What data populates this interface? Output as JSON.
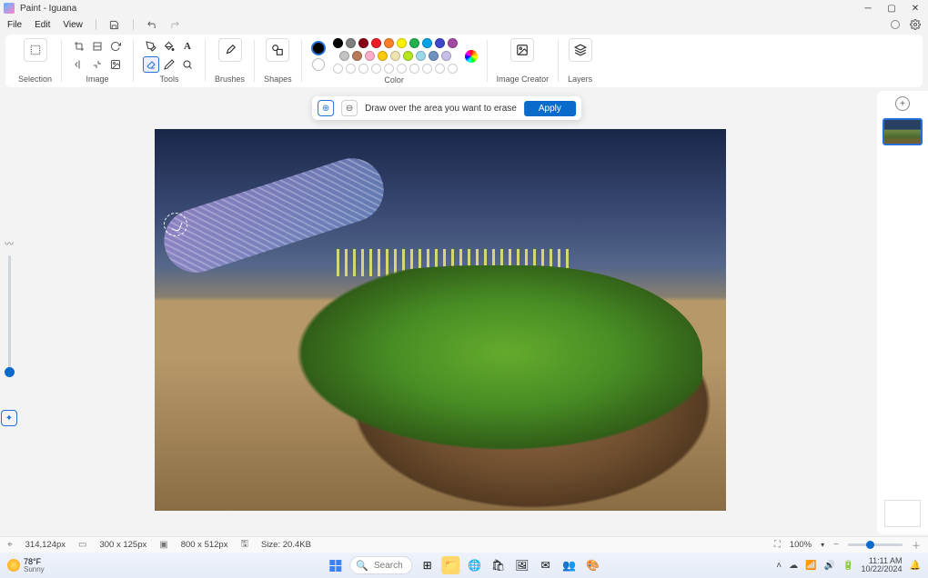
{
  "titlebar": {
    "title": "Paint - Iguana"
  },
  "menu": {
    "file": "File",
    "edit": "Edit",
    "view": "View"
  },
  "ribbon": {
    "selection": "Selection",
    "image": "Image",
    "tools": "Tools",
    "brushes": "Brushes",
    "shapes": "Shapes",
    "color": "Color",
    "image_creator": "Image Creator",
    "layers": "Layers"
  },
  "palette": {
    "row1": [
      "#000000",
      "#7f7f7f",
      "#880015",
      "#ed1c24",
      "#ff7f27",
      "#fff200",
      "#22b14c",
      "#00a2e8",
      "#3f48cc",
      "#a349a4"
    ],
    "row2": [
      "#c3c3c3",
      "#b97a57",
      "#ffaec9",
      "#ffc90e",
      "#efe4b0",
      "#b5e61d",
      "#99d9ea",
      "#7092be",
      "#c8bfe7"
    ],
    "primary": "#000000",
    "secondary": "#ffffff"
  },
  "floatbar": {
    "hint": "Draw over the area you want to erase",
    "apply": "Apply"
  },
  "status": {
    "cursor": "314,124px",
    "selection": "300  x  125px",
    "canvas": "800  x  512px",
    "size": "Size: 20.4KB",
    "zoom": "100%"
  },
  "taskbar": {
    "temp": "78°F",
    "cond": "Sunny",
    "search_placeholder": "Search",
    "time": "11:11 AM",
    "date": "10/22/2024"
  }
}
